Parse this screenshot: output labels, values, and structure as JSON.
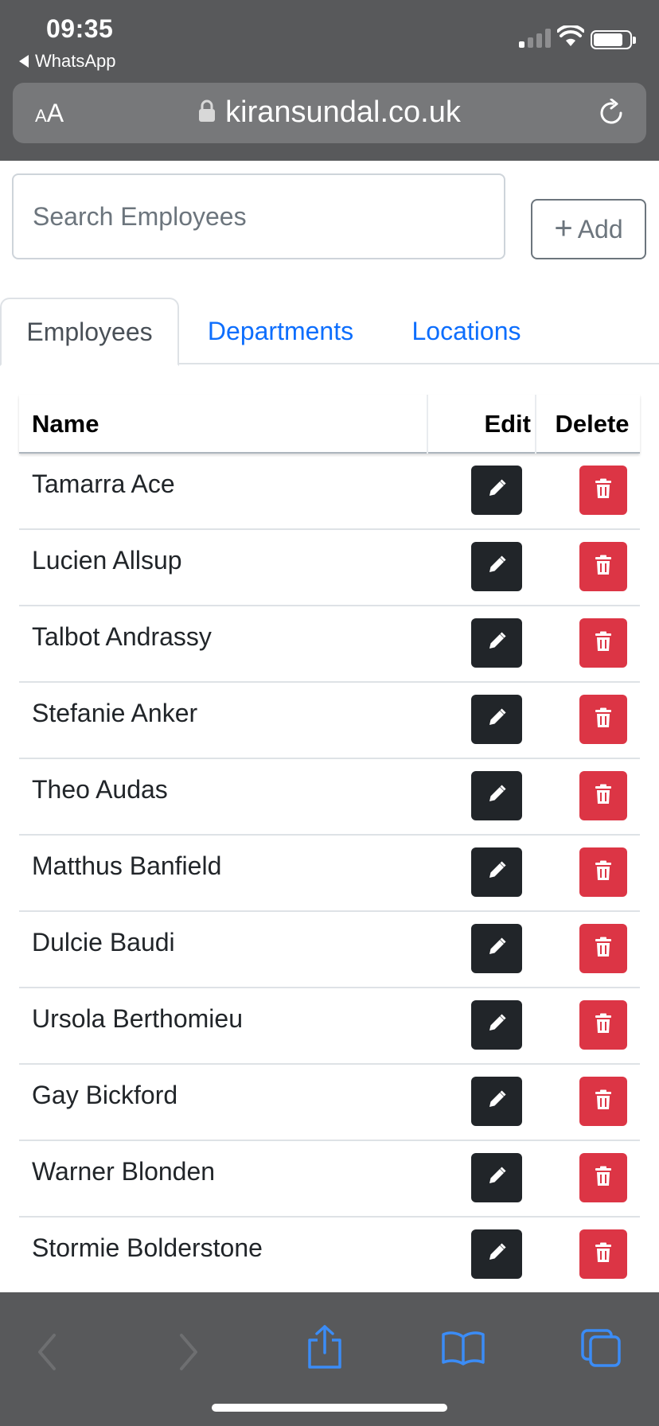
{
  "status_bar": {
    "time": "09:35",
    "back_app": "WhatsApp"
  },
  "browser": {
    "text_size_small": "A",
    "text_size_large": "A",
    "url": "kiransundal.co.uk"
  },
  "search": {
    "placeholder": "Search Employees"
  },
  "add_button": {
    "label": "Add"
  },
  "tabs": [
    {
      "label": "Employees",
      "active": true
    },
    {
      "label": "Departments",
      "active": false
    },
    {
      "label": "Locations",
      "active": false
    }
  ],
  "table": {
    "headers": {
      "name": "Name",
      "edit": "Edit",
      "delete": "Delete"
    },
    "rows": [
      {
        "name": "Tamarra Ace"
      },
      {
        "name": "Lucien Allsup"
      },
      {
        "name": "Talbot Andrassy"
      },
      {
        "name": "Stefanie Anker"
      },
      {
        "name": "Theo Audas"
      },
      {
        "name": "Matthus Banfield"
      },
      {
        "name": "Dulcie Baudi"
      },
      {
        "name": "Ursola Berthomieu"
      },
      {
        "name": "Gay Bickford"
      },
      {
        "name": "Warner Blonden"
      },
      {
        "name": "Stormie Bolderstone"
      }
    ]
  },
  "toolbar": {
    "icons": [
      "back-icon",
      "forward-icon",
      "share-icon",
      "bookmarks-icon",
      "tabs-icon"
    ]
  },
  "colors": {
    "chrome_bg": "#58595b",
    "link_blue": "#0d6efd",
    "edit_button": "#212529",
    "delete_button": "#dc3545",
    "toolbar_icon": "#3b8cf6"
  }
}
